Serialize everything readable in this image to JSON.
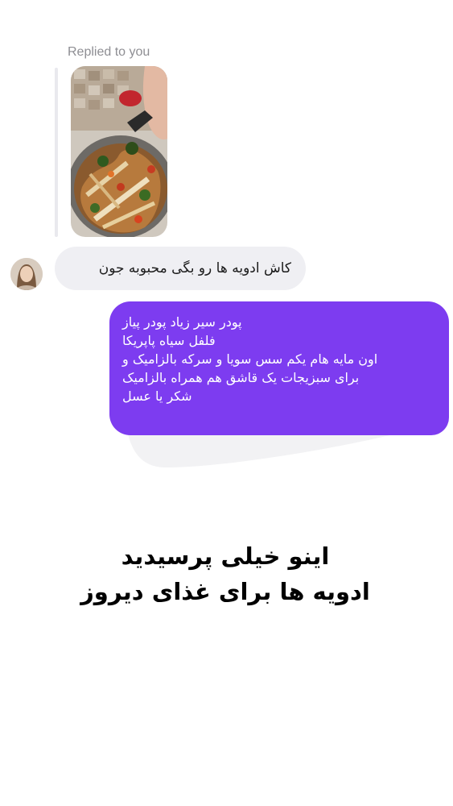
{
  "thread": {
    "replied_label": "Replied to you",
    "shared_image_icon": "food-photo"
  },
  "received_message": {
    "text": "کاش ادویه ها رو بگی محبوبه جون"
  },
  "sent_message": {
    "lines": [
      "پودر سیر زیاد پودر پیاز",
      "فلفل سیاه پاپریکا",
      "اون مایه هام یکم سس سویا و سرکه بالزامیک و",
      "برای سبزیجات یک قاشق هم همراه بالزامیک",
      "شکر یا عسل"
    ]
  },
  "caption": {
    "line1": "اینو خیلی پرسیدید",
    "line2": "ادویه ها برای غذای دیروز"
  },
  "colors": {
    "sent_bubble": "#7d3cf0",
    "received_bubble": "#efeff3",
    "background": "#ffffff"
  }
}
